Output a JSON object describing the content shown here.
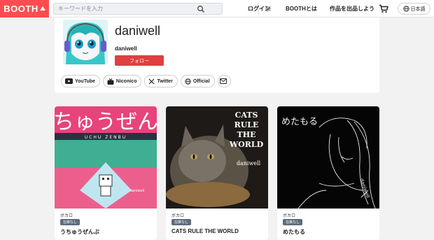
{
  "header": {
    "logo": "BOOTH",
    "search_placeholder": "キーワードを入力",
    "nav": [
      "ログイン",
      "BOOTHとは",
      "作品を出品しよう"
    ],
    "language": "日本語"
  },
  "profile": {
    "title": "daniwell",
    "username": "daniwell",
    "follow_label": "フォロー",
    "links": [
      "YouTube",
      "Niconico",
      "Twitter",
      "Official"
    ]
  },
  "products": [
    {
      "category": "ボカロ",
      "stock": "在庫なし",
      "title": "うちゅうぜんぶ",
      "cover_text": "うちゅうぜんぶ",
      "cover_sub": "UCHU ZENBU",
      "cover_credit": "daniwell"
    },
    {
      "category": "ボカロ",
      "stock": "在庫なし",
      "title": "CATS RULE THE WORLD",
      "cover_text": "CATS RULE THE WORLD",
      "cover_credit": "daniwell"
    },
    {
      "category": "ボカロ",
      "stock": "在庫なし",
      "title": "めたもる",
      "cover_text": "めたもる",
      "cover_credit": "daniwell"
    }
  ],
  "colors": {
    "brand": "#fc4d50",
    "follow": "#e04040",
    "badge": "#5d6b7a"
  },
  "icons": [
    "booth-logo-icon",
    "search-icon",
    "filter-icon",
    "cart-icon",
    "globe-icon",
    "youtube-icon",
    "niconico-icon",
    "x-twitter-icon",
    "globe-icon",
    "mail-icon"
  ]
}
